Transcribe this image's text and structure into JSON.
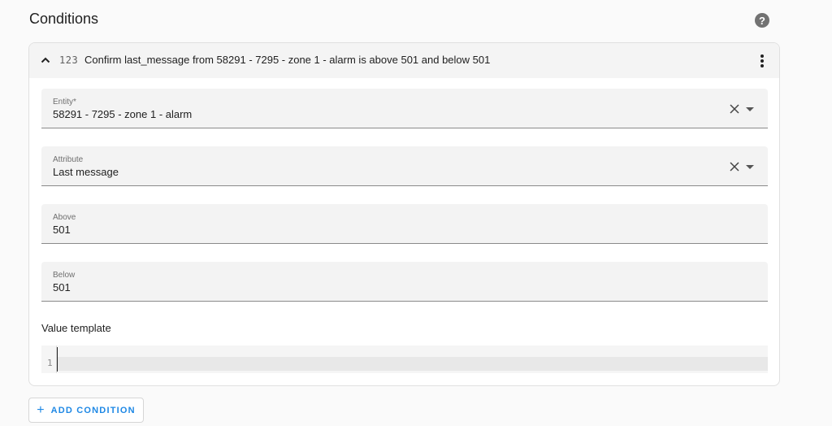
{
  "section": {
    "title": "Conditions"
  },
  "help": {
    "glyph": "?"
  },
  "card": {
    "numeric_glyph": "123",
    "title": "Confirm last_message from 58291 - 7295 - zone 1 - alarm is above 501 and below 501"
  },
  "fields": {
    "entity": {
      "label": "Entity*",
      "value": "58291 - 7295 - zone 1 - alarm"
    },
    "attribute": {
      "label": "Attribute",
      "value": "Last message"
    },
    "above": {
      "label": "Above",
      "value": "501"
    },
    "below": {
      "label": "Below",
      "value": "501"
    }
  },
  "value_template": {
    "label": "Value template",
    "line_number": "1"
  },
  "add_condition": {
    "icon": "+",
    "label": "ADD CONDITION"
  },
  "colors": {
    "accent": "#1e88e5",
    "field_bg": "#f3f3f3",
    "header_bg": "#f4f4f4"
  }
}
